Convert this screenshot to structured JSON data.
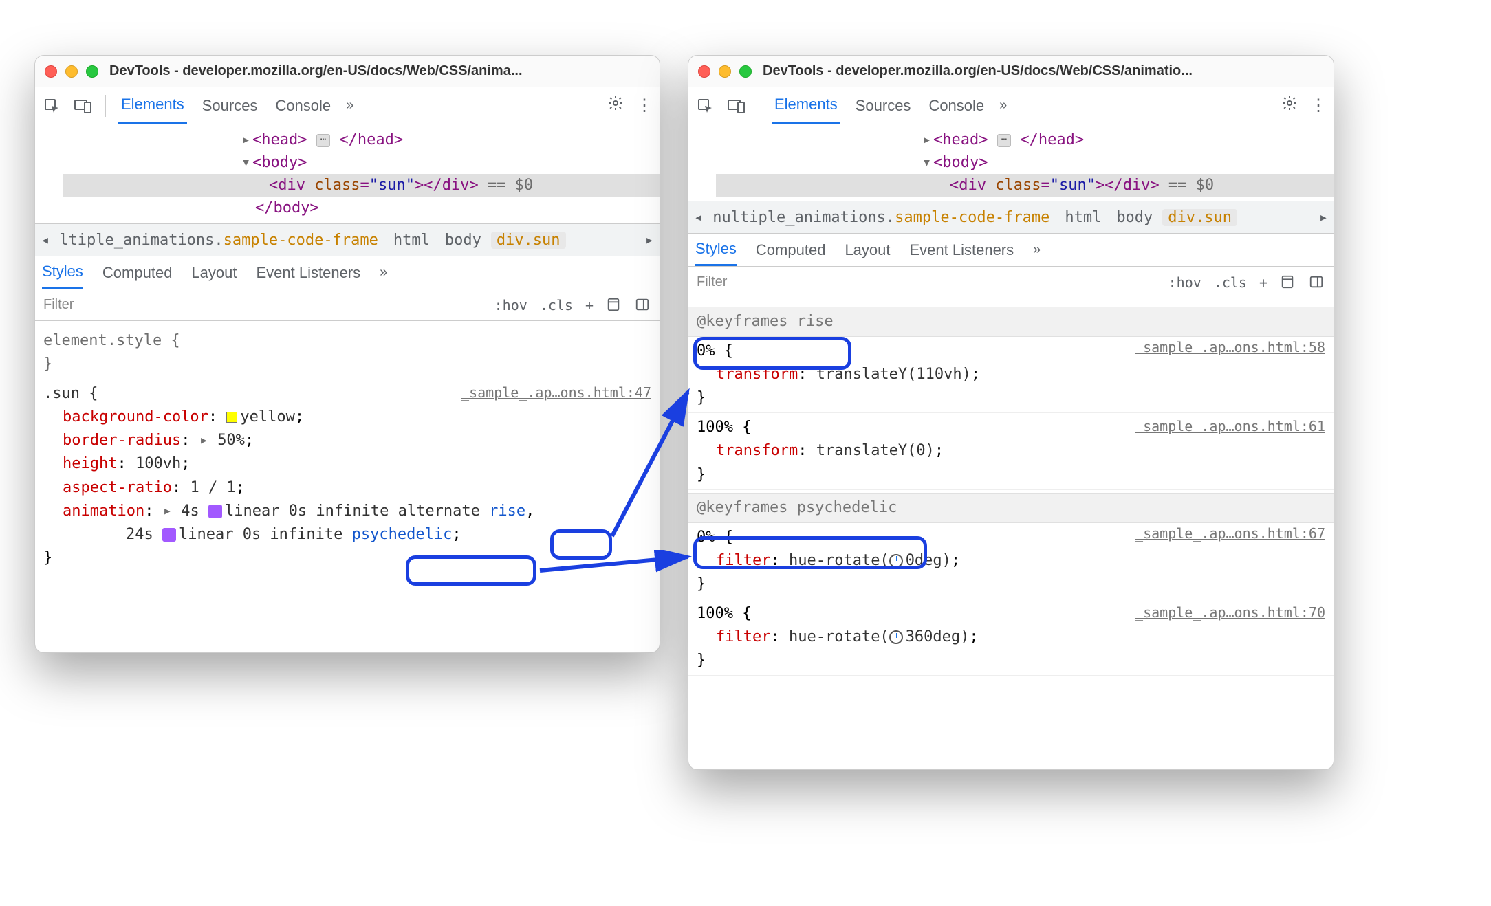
{
  "left": {
    "title": "DevTools - developer.mozilla.org/en-US/docs/Web/CSS/anima...",
    "tabs": {
      "elements": "Elements",
      "sources": "Sources",
      "console": "Console",
      "more": "»"
    },
    "dom": {
      "head_open": "<head>",
      "head_close": "</head>",
      "body_open": "<body>",
      "div_open": "<div ",
      "div_attr_n": "class",
      "div_attr_v": "\"sun\"",
      "div_mid": "=",
      "div_close": "></div>",
      "eq0": " == $0",
      "body_close": "</body>"
    },
    "crumb": {
      "p0": "ltiple_animations.",
      "p0b": "sample-code-frame",
      "p1": "html",
      "p2": "body",
      "p3": "div.sun"
    },
    "stabs": {
      "styles": "Styles",
      "computed": "Computed",
      "layout": "Layout",
      "ev": "Event Listeners",
      "more": "»"
    },
    "filter": {
      "placeholder": "Filter",
      "hov": ":hov",
      "cls": ".cls",
      "plus": "+"
    },
    "rules": {
      "elstyle_sel": "element.style {",
      "elstyle_close": "}",
      "sun_sel": ".sun {",
      "sun_src": "_sample_.ap…ons.html:47",
      "bgcolor_p": "background-color",
      "bgcolor_v": "yellow",
      "bradius_p": "border-radius",
      "bradius_v": "50%",
      "height_p": "height",
      "height_v": "100vh",
      "aspect_p": "aspect-ratio",
      "aspect_v": "1 / 1",
      "anim_p": "animation",
      "anim_v1a": "4s ",
      "anim_v1b": "linear 0s infinite alternate ",
      "anim_v1c": "rise",
      "anim_v2a": "24s ",
      "anim_v2b": "linear 0s infinite ",
      "anim_v2c": "psychedelic",
      "sun_close": "}"
    }
  },
  "right": {
    "title": "DevTools - developer.mozilla.org/en-US/docs/Web/CSS/animatio...",
    "tabs": {
      "elements": "Elements",
      "sources": "Sources",
      "console": "Console",
      "more": "»"
    },
    "dom": {
      "head_open": "<head>",
      "head_close": "</head>",
      "body_open": "<body>",
      "div_open": "<div ",
      "div_attr_n": "class",
      "div_attr_v": "\"sun\"",
      "div_mid": "=",
      "div_close": "></div>",
      "eq0": " == $0",
      "body_close": "</body>"
    },
    "crumb": {
      "p0": "nultiple_animations.",
      "p0b": "sample-code-frame",
      "p1": "html",
      "p2": "body",
      "p3": "div.sun"
    },
    "stabs": {
      "styles": "Styles",
      "computed": "Computed",
      "layout": "Layout",
      "ev": "Event Listeners",
      "more": "»"
    },
    "filter": {
      "placeholder": "Filter",
      "hov": ":hov",
      "cls": ".cls",
      "plus": "+"
    },
    "kf": {
      "rise_head": "@keyframes rise",
      "k0_open": "0% {",
      "k0_src": "_sample_.ap…ons.html:58",
      "k0_prop": "transform",
      "k0_val": "translateY(110vh)",
      "brace_close": "}",
      "k100_open": "100% {",
      "k100_src": "_sample_.ap…ons.html:61",
      "k100_prop": "transform",
      "k100_val": "translateY(0)",
      "psy_head": "@keyframes psychedelic",
      "p0_open": "0% {",
      "p0_src": "_sample_.ap…ons.html:67",
      "p0_prop": "filter",
      "p0_val": "hue-rotate(",
      "p0_val2": "0deg)",
      "p100_open": "100% {",
      "p100_src": "_sample_.ap…ons.html:70",
      "p100_prop": "filter",
      "p100_val": "hue-rotate(",
      "p100_val2": "360deg)"
    }
  }
}
